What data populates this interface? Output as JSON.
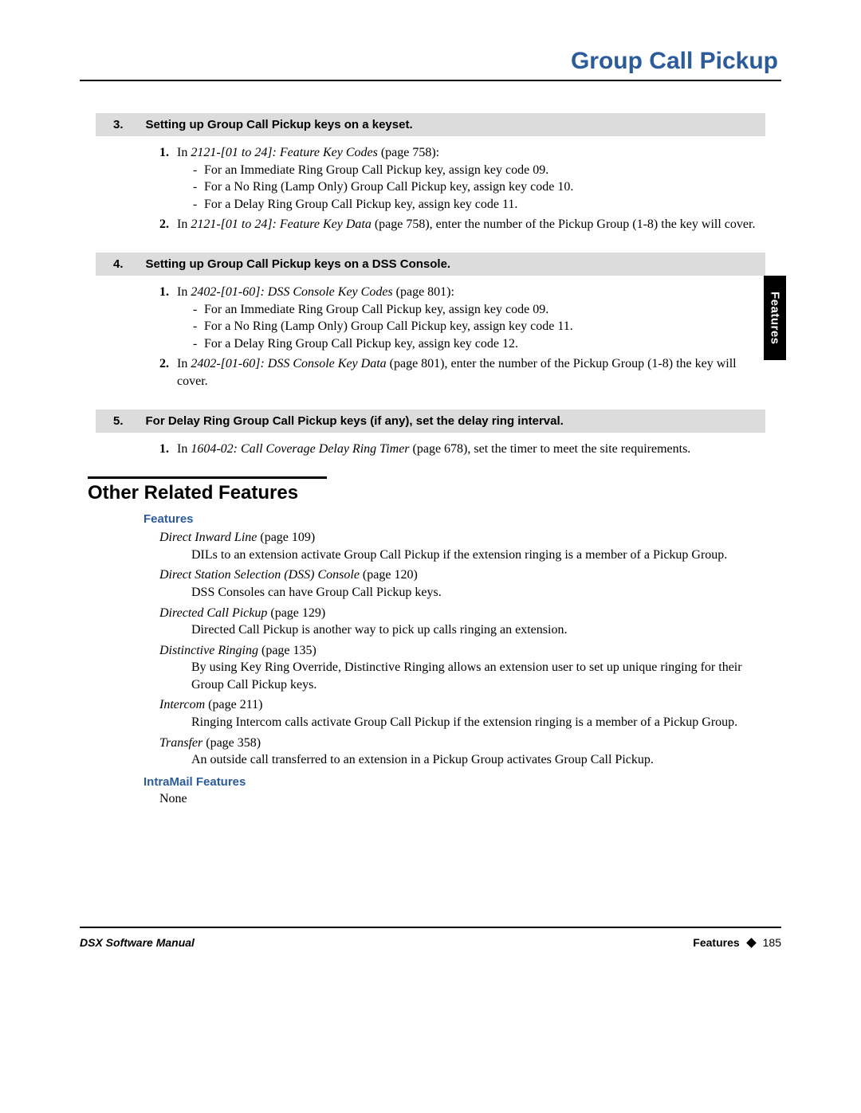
{
  "header": {
    "title": "Group Call Pickup"
  },
  "sideTab": "Features",
  "steps": [
    {
      "num": "3.",
      "title": "Setting up Group Call Pickup keys on a keyset.",
      "items": [
        {
          "prefixIn": "In ",
          "ref": "2121-[01 to 24]: Feature Key Codes",
          "suffix": " (page 758):",
          "sub": [
            "For an Immediate Ring Group Call Pickup key, assign key code 09.",
            "For a No Ring (Lamp Only) Group Call Pickup key, assign key code 10.",
            "For a Delay Ring Group Call Pickup key, assign key code 11."
          ]
        },
        {
          "prefixIn": "In ",
          "ref": "2121-[01 to 24]: Feature Key Data",
          "suffix": " (page 758), enter the number of the Pickup Group (1-8) the key will cover."
        }
      ]
    },
    {
      "num": "4.",
      "title": "Setting up Group Call Pickup keys on a DSS Console.",
      "items": [
        {
          "prefixIn": "In ",
          "ref": "2402-[01-60]: DSS Console Key Codes",
          "suffix": " (page 801):",
          "sub": [
            "For an Immediate Ring Group Call Pickup key, assign key code 09.",
            "For a No Ring (Lamp Only) Group Call Pickup key, assign key code 11.",
            "For a Delay Ring Group Call Pickup key, assign key code 12."
          ]
        },
        {
          "prefixIn": "In ",
          "ref": "2402-[01-60]: DSS Console Key Data",
          "suffix": " (page 801), enter the number of the Pickup Group (1-8) the key will cover."
        }
      ]
    },
    {
      "num": "5.",
      "title": "For Delay Ring Group Call Pickup keys (if any), set the delay ring interval.",
      "items": [
        {
          "prefixIn": "In ",
          "ref": "1604-02: Call Coverage Delay Ring Timer",
          "suffix": " (page 678), set the timer to meet the site requirements."
        }
      ]
    }
  ],
  "related": {
    "sectionTitle": "Other Related Features",
    "featuresHeading": "Features",
    "features": [
      {
        "ref": "Direct Inward Line",
        "page": " (page 109)",
        "desc": "DILs to an extension activate Group Call Pickup if the extension ringing is a member of a Pickup Group."
      },
      {
        "ref": "Direct Station Selection (DSS) Console",
        "page": " (page 120)",
        "desc": "DSS Consoles can have Group Call Pickup keys."
      },
      {
        "ref": "Directed Call Pickup",
        "page": " (page 129)",
        "desc": "Directed Call Pickup is another way to pick up calls ringing an extension."
      },
      {
        "ref": "Distinctive Ringing",
        "page": " (page 135)",
        "desc": "By using Key Ring Override, Distinctive Ringing allows an extension user to set up unique ringing for their Group Call Pickup keys."
      },
      {
        "ref": "Intercom",
        "page": " (page 211)",
        "desc": "Ringing Intercom calls activate Group Call Pickup if the extension ringing is a member of a Pickup Group."
      },
      {
        "ref": "Transfer",
        "page": " (page 358)",
        "desc": "An outside call transferred to an extension in a Pickup Group activates Group Call Pickup."
      }
    ],
    "intramailHeading": "IntraMail Features",
    "intramailNone": "None"
  },
  "footer": {
    "left": "DSX Software Manual",
    "rightLabel": "Features",
    "pageNum": "185"
  }
}
